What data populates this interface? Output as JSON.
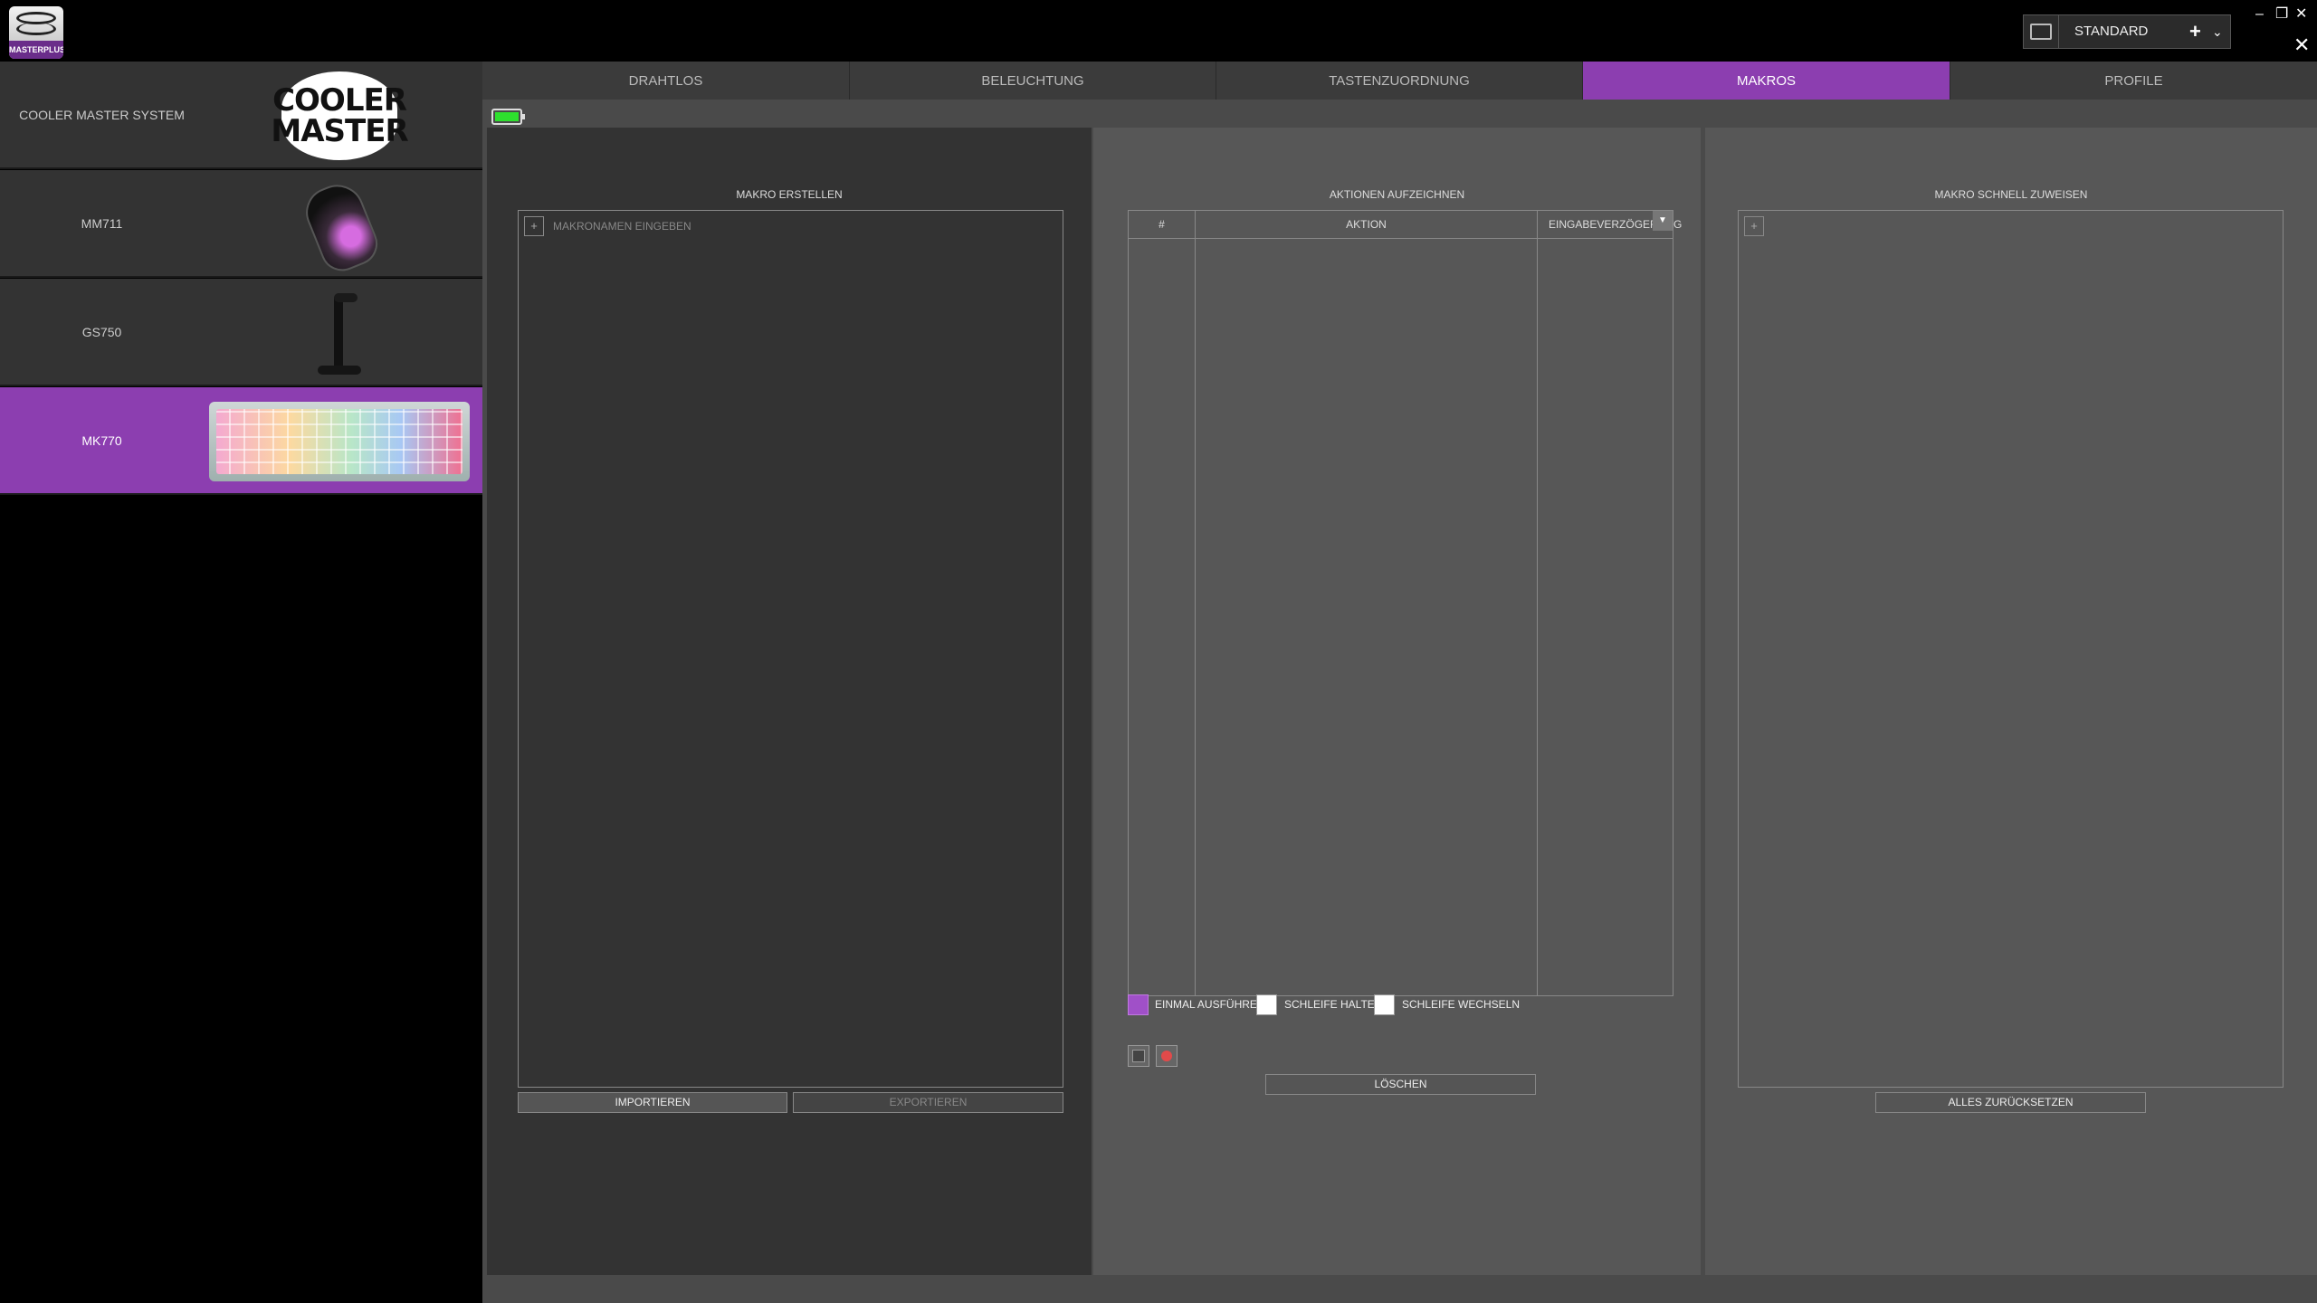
{
  "app": {
    "brand": "MASTERPLUS+",
    "profile": "STANDARD"
  },
  "devices": [
    {
      "label": "COOLER MASTER SYSTEM",
      "image": "cooler-master-logo",
      "logo_lines": [
        "COOLER",
        "MASTER"
      ]
    },
    {
      "label": "MM711",
      "image": "mouse"
    },
    {
      "label": "GS750",
      "image": "headset-stand"
    },
    {
      "label": "MK770",
      "image": "keyboard",
      "active": true
    }
  ],
  "tabs": [
    {
      "label": "DRAHTLOS"
    },
    {
      "label": "BELEUCHTUNG"
    },
    {
      "label": "TASTENZUORDNUNG"
    },
    {
      "label": "MAKROS",
      "active": true
    },
    {
      "label": "PROFILE"
    }
  ],
  "battery": {
    "level": 1.0,
    "color": "#2ee02e"
  },
  "create_macro": {
    "title": "MAKRO ERSTELLEN",
    "name_placeholder": "MAKRONAMEN EINGEBEN",
    "import_label": "IMPORTIEREN",
    "export_label": "EXPORTIEREN"
  },
  "record": {
    "title": "AKTIONEN AUFZEICHNEN",
    "columns": [
      "#",
      "AKTION",
      "EINGABEVERZÖGERUNG"
    ],
    "options": [
      {
        "label": "EINMAL AUSFÜHREN",
        "checked": true
      },
      {
        "label": "SCHLEIFE HALTEN",
        "checked": false
      },
      {
        "label": "SCHLEIFE WECHSELN",
        "checked": false
      }
    ],
    "delete_label": "LÖSCHEN"
  },
  "quick_assign": {
    "title": "MAKRO SCHNELL ZUWEISEN",
    "reset_label": "ALLES ZURÜCKSETZEN"
  },
  "colors": {
    "accent": "#8c3eb0",
    "panel_dark": "#333333",
    "panel": "#575757"
  }
}
